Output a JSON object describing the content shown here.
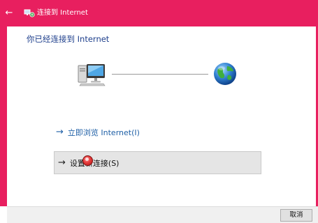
{
  "titlebar": {
    "title": "连接到 Internet",
    "back_icon": "back-arrow-icon",
    "app_icon": "network-icon"
  },
  "main": {
    "heading": "你已经连接到 Internet",
    "diagram": {
      "left_icon": "computer-icon",
      "right_icon": "globe-icon"
    },
    "links": [
      {
        "label": "立即浏览 Internet(I)"
      }
    ],
    "option": {
      "label": "设置新连接(S)"
    }
  },
  "footer": {
    "cancel_label": "取消"
  },
  "colors": {
    "accent": "#e81f5f",
    "heading": "#1e3f8c",
    "link": "#1e5fa6"
  }
}
